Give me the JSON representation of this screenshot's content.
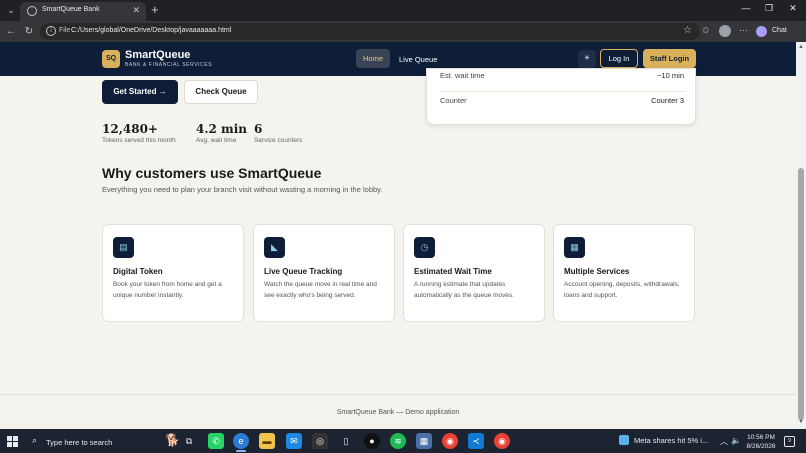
{
  "browser": {
    "tab_title": "SmartQueue Bank",
    "tab_close": "✕",
    "new_tab": "+",
    "address_scheme": "File",
    "address_url": "C:/Users/global/OneDrive/Desktop/javaaaaaaa.html",
    "chat_label": "Chat"
  },
  "header": {
    "logo_initials": "SQ",
    "brand_name": "SmartQueue",
    "brand_tagline": "BANK & FINANCIAL SERVICES",
    "nav": [
      {
        "label": "Home",
        "active": true
      },
      {
        "label": "Live Queue",
        "active": false
      }
    ],
    "theme_toggle": "☀",
    "login_label": "Log In",
    "staff_login_label": "Staff Login"
  },
  "hero": {
    "get_started_label": "Get Started →",
    "check_queue_label": "Check Queue",
    "stats": [
      {
        "value": "12,480+",
        "label": "Tokens served this month"
      },
      {
        "value": "4.2 min",
        "label": "Avg. wait time"
      },
      {
        "value": "6",
        "label": "Service counters"
      }
    ]
  },
  "queue_card": {
    "rows": [
      {
        "key": "Est. wait time",
        "value": "~10 min"
      },
      {
        "key": "Counter",
        "value": "Counter 3"
      }
    ]
  },
  "features": {
    "title": "Why customers use SmartQueue",
    "subtitle": "Everything you need to plan your branch visit without wasting a morning in the lobby.",
    "items": [
      {
        "icon": "token-icon",
        "glyph": "▤",
        "title": "Digital Token",
        "desc": "Book your token from home and get a unique number instantly."
      },
      {
        "icon": "tracking-icon",
        "glyph": "◣",
        "title": "Live Queue Tracking",
        "desc": "Watch the queue move in real time and see exactly who's being served."
      },
      {
        "icon": "timer-icon",
        "glyph": "◷",
        "title": "Estimated Wait Time",
        "desc": "A running estimate that updates automatically as the queue moves."
      },
      {
        "icon": "services-icon",
        "glyph": "▦",
        "title": "Multiple Services",
        "desc": "Account opening, deposits, withdrawals, loans and support."
      }
    ]
  },
  "footer": {
    "text": "SmartQueue Bank — Demo application"
  },
  "taskbar": {
    "search_placeholder": "Type here to search",
    "news_text": "Meta shares hit 5% i...",
    "time": "10:56 PM",
    "date": "8/26/2026",
    "notification_count": "9"
  }
}
